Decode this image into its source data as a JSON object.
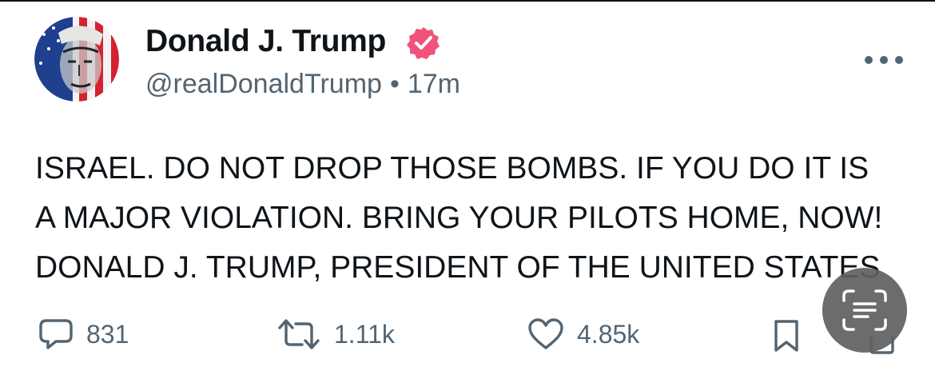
{
  "post": {
    "author": {
      "display_name": "Donald J. Trump",
      "handle": "@realDonaldTrump",
      "verified_icon": "verified-badge-icon",
      "avatar": "avatar-image"
    },
    "separator": "•",
    "time_ago": "17m",
    "lines": [
      "ISRAEL. DO NOT DROP THOSE BOMBS. IF YOU DO IT IS",
      "A MAJOR VIOLATION. BRING YOUR PILOTS HOME, NOW!",
      "DONALD J. TRUMP, PRESIDENT OF THE UNITED STATES"
    ]
  },
  "actions": {
    "replies": "831",
    "reposts": "1.11k",
    "likes": "4.85k"
  },
  "overlay": {
    "icon": "scan-text-icon"
  },
  "colors": {
    "text": "#0f1419",
    "secondary": "#536471",
    "verified": "#f0527a",
    "overlay": "#5f5f5f"
  }
}
